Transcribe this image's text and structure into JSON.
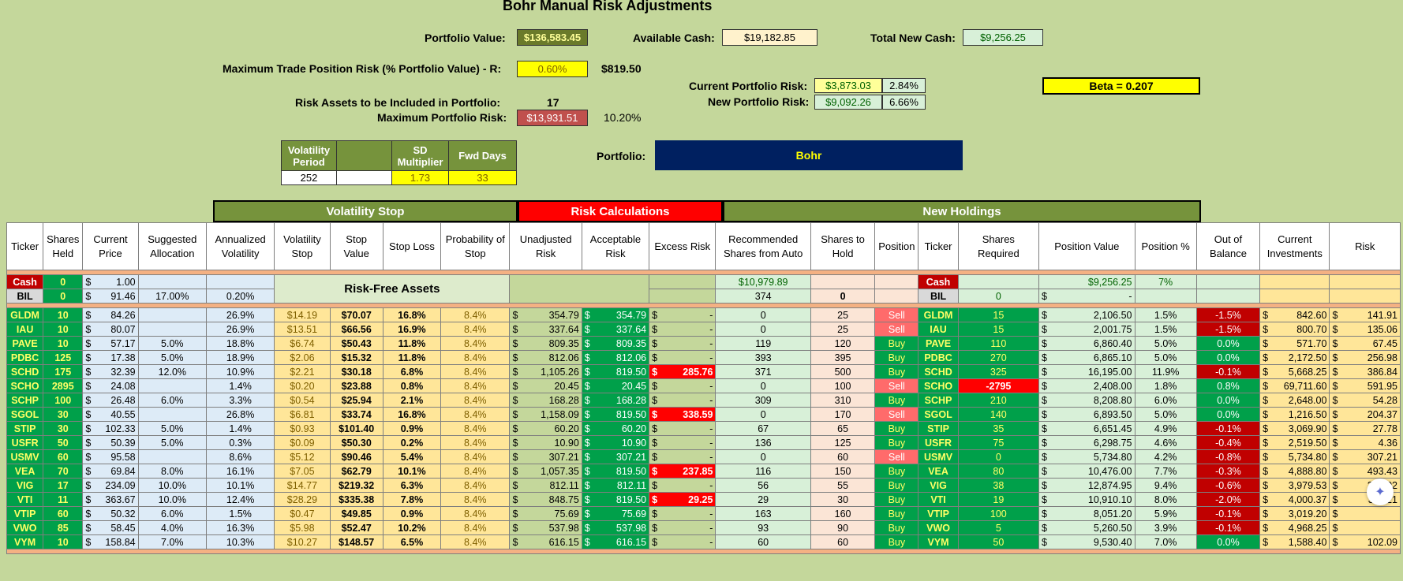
{
  "title": "Bohr Manual Risk Adjustments",
  "top": {
    "portfolio_value_label": "Portfolio Value:",
    "portfolio_value": "$136,583.45",
    "available_cash_label": "Available Cash:",
    "available_cash": "$19,182.85",
    "total_new_cash_label": "Total New Cash:",
    "total_new_cash": "$9,256.25",
    "max_trade_label": "Maximum Trade Position Risk (% Portfolio Value) - R:",
    "max_trade_pct": "0.60%",
    "max_trade_value": "$819.50",
    "current_risk_label": "Current Portfolio Risk:",
    "current_risk_value": "$3,873.03",
    "current_risk_pct": "2.84%",
    "new_risk_label": "New Portfolio Risk:",
    "new_risk_value": "$9,092.26",
    "new_risk_pct": "6.66%",
    "beta": "Beta = 0.207",
    "risk_assets_label": "Risk Assets to be Included in Portfolio:",
    "risk_assets_count": "17",
    "max_portfolio_risk_label": "Maximum Portfolio Risk:",
    "max_portfolio_risk_value": "$13,931.51",
    "max_portfolio_risk_pct": "10.20%",
    "portfolio_label": "Portfolio:",
    "portfolio_name": "Bohr"
  },
  "params": {
    "h1": "Volatility Period",
    "h2": "",
    "h3": "SD Multiplier",
    "h4": "Fwd Days",
    "v1": "252",
    "v2": "",
    "v3": "1.73",
    "v4": "33"
  },
  "groups": {
    "volatility_stop": "Volatility Stop",
    "risk_calculations": "Risk Calculations",
    "new_holdings": "New Holdings"
  },
  "headers": [
    "Ticker",
    "Shares Held",
    "Current Price",
    "Suggested Allocation",
    "Annualized Volatility",
    "Volatility Stop",
    "Stop Value",
    "Stop Loss",
    "Probability of Stop",
    "Unadjusted Risk",
    "Acceptable Risk",
    "Excess Risk",
    "Recommended Shares from Auto",
    "Shares to Hold",
    "Position",
    "Ticker",
    "Shares Required",
    "Position Value",
    "Position %",
    "Out of Balance",
    "Current Investments",
    "Risk"
  ],
  "cash_row": {
    "ticker": "Cash",
    "shares": "0",
    "price": "1.00",
    "rec": "$10,979.89",
    "ticker2": "Cash",
    "pos_value": "$9,256.25",
    "pos_pct": "7%"
  },
  "bil_row": {
    "ticker": "BIL",
    "shares": "0",
    "price": "91.46",
    "alloc": "17.00%",
    "vol": "0.20%",
    "label": "Risk-Free Assets",
    "rec": "374",
    "hold": "0",
    "ticker2": "BIL",
    "req": "0",
    "pos_value": "-"
  },
  "rows": [
    {
      "t": "GLDM",
      "s": "10",
      "p": "84.26",
      "a": "",
      "v": "26.9%",
      "vs": "$14.19",
      "sv": "$70.07",
      "sl": "16.8%",
      "pb": "8.4%",
      "ur": "354.79",
      "ar": "354.79",
      "ex": "-",
      "rec": "0",
      "hold": "25",
      "pos": "Sell",
      "req": "15",
      "pv": "2,106.50",
      "pp": "1.5%",
      "ob": "-1.5%",
      "ci": "842.60",
      "rk": "141.91"
    },
    {
      "t": "IAU",
      "s": "10",
      "p": "80.07",
      "a": "",
      "v": "26.9%",
      "vs": "$13.51",
      "sv": "$66.56",
      "sl": "16.9%",
      "pb": "8.4%",
      "ur": "337.64",
      "ar": "337.64",
      "ex": "-",
      "rec": "0",
      "hold": "25",
      "pos": "Sell",
      "req": "15",
      "pv": "2,001.75",
      "pp": "1.5%",
      "ob": "-1.5%",
      "ci": "800.70",
      "rk": "135.06"
    },
    {
      "t": "PAVE",
      "s": "10",
      "p": "57.17",
      "a": "5.0%",
      "v": "18.8%",
      "vs": "$6.74",
      "sv": "$50.43",
      "sl": "11.8%",
      "pb": "8.4%",
      "ur": "809.35",
      "ar": "809.35",
      "ex": "-",
      "rec": "119",
      "hold": "120",
      "pos": "Buy",
      "req": "110",
      "pv": "6,860.40",
      "pp": "5.0%",
      "ob": "0.0%",
      "ci": "571.70",
      "rk": "67.45"
    },
    {
      "t": "PDBC",
      "s": "125",
      "p": "17.38",
      "a": "5.0%",
      "v": "18.9%",
      "vs": "$2.06",
      "sv": "$15.32",
      "sl": "11.8%",
      "pb": "8.4%",
      "ur": "812.06",
      "ar": "812.06",
      "ex": "-",
      "rec": "393",
      "hold": "395",
      "pos": "Buy",
      "req": "270",
      "pv": "6,865.10",
      "pp": "5.0%",
      "ob": "0.0%",
      "ci": "2,172.50",
      "rk": "256.98"
    },
    {
      "t": "SCHD",
      "s": "175",
      "p": "32.39",
      "a": "12.0%",
      "v": "10.9%",
      "vs": "$2.21",
      "sv": "$30.18",
      "sl": "6.8%",
      "pb": "8.4%",
      "ur": "1,105.26",
      "ar": "819.50",
      "ex": "285.76",
      "rec": "371",
      "hold": "500",
      "pos": "Buy",
      "req": "325",
      "pv": "16,195.00",
      "pp": "11.9%",
      "ob": "-0.1%",
      "ci": "5,668.25",
      "rk": "386.84"
    },
    {
      "t": "SCHO",
      "s": "2895",
      "p": "24.08",
      "a": "",
      "v": "1.4%",
      "vs": "$0.20",
      "sv": "$23.88",
      "sl": "0.8%",
      "pb": "8.4%",
      "ur": "20.45",
      "ar": "20.45",
      "ex": "-",
      "rec": "0",
      "hold": "100",
      "pos": "Sell",
      "req": "-2795",
      "pv": "2,408.00",
      "pp": "1.8%",
      "ob": "0.8%",
      "ci": "69,711.60",
      "rk": "591.95"
    },
    {
      "t": "SCHP",
      "s": "100",
      "p": "26.48",
      "a": "6.0%",
      "v": "3.3%",
      "vs": "$0.54",
      "sv": "$25.94",
      "sl": "2.1%",
      "pb": "8.4%",
      "ur": "168.28",
      "ar": "168.28",
      "ex": "-",
      "rec": "309",
      "hold": "310",
      "pos": "Buy",
      "req": "210",
      "pv": "8,208.80",
      "pp": "6.0%",
      "ob": "0.0%",
      "ci": "2,648.00",
      "rk": "54.28"
    },
    {
      "t": "SGOL",
      "s": "30",
      "p": "40.55",
      "a": "",
      "v": "26.8%",
      "vs": "$6.81",
      "sv": "$33.74",
      "sl": "16.8%",
      "pb": "8.4%",
      "ur": "1,158.09",
      "ar": "819.50",
      "ex": "338.59",
      "rec": "0",
      "hold": "170",
      "pos": "Sell",
      "req": "140",
      "pv": "6,893.50",
      "pp": "5.0%",
      "ob": "0.0%",
      "ci": "1,216.50",
      "rk": "204.37"
    },
    {
      "t": "STIP",
      "s": "30",
      "p": "102.33",
      "a": "5.0%",
      "v": "1.4%",
      "vs": "$0.93",
      "sv": "$101.40",
      "sl": "0.9%",
      "pb": "8.4%",
      "ur": "60.20",
      "ar": "60.20",
      "ex": "-",
      "rec": "67",
      "hold": "65",
      "pos": "Buy",
      "req": "35",
      "pv": "6,651.45",
      "pp": "4.9%",
      "ob": "-0.1%",
      "ci": "3,069.90",
      "rk": "27.78"
    },
    {
      "t": "USFR",
      "s": "50",
      "p": "50.39",
      "a": "5.0%",
      "v": "0.3%",
      "vs": "$0.09",
      "sv": "$50.30",
      "sl": "0.2%",
      "pb": "8.4%",
      "ur": "10.90",
      "ar": "10.90",
      "ex": "-",
      "rec": "136",
      "hold": "125",
      "pos": "Buy",
      "req": "75",
      "pv": "6,298.75",
      "pp": "4.6%",
      "ob": "-0.4%",
      "ci": "2,519.50",
      "rk": "4.36"
    },
    {
      "t": "USMV",
      "s": "60",
      "p": "95.58",
      "a": "",
      "v": "8.6%",
      "vs": "$5.12",
      "sv": "$90.46",
      "sl": "5.4%",
      "pb": "8.4%",
      "ur": "307.21",
      "ar": "307.21",
      "ex": "-",
      "rec": "0",
      "hold": "60",
      "pos": "Sell",
      "req": "0",
      "pv": "5,734.80",
      "pp": "4.2%",
      "ob": "-0.8%",
      "ci": "5,734.80",
      "rk": "307.21"
    },
    {
      "t": "VEA",
      "s": "70",
      "p": "69.84",
      "a": "8.0%",
      "v": "16.1%",
      "vs": "$7.05",
      "sv": "$62.79",
      "sl": "10.1%",
      "pb": "8.4%",
      "ur": "1,057.35",
      "ar": "819.50",
      "ex": "237.85",
      "rec": "116",
      "hold": "150",
      "pos": "Buy",
      "req": "80",
      "pv": "10,476.00",
      "pp": "7.7%",
      "ob": "-0.3%",
      "ci": "4,888.80",
      "rk": "493.43"
    },
    {
      "t": "VIG",
      "s": "17",
      "p": "234.09",
      "a": "10.0%",
      "v": "10.1%",
      "vs": "$14.77",
      "sv": "$219.32",
      "sl": "6.3%",
      "pb": "8.4%",
      "ur": "812.11",
      "ar": "812.11",
      "ex": "-",
      "rec": "56",
      "hold": "55",
      "pos": "Buy",
      "req": "38",
      "pv": "12,874.95",
      "pp": "9.4%",
      "ob": "-0.6%",
      "ci": "3,979.53",
      "rk": "251.02"
    },
    {
      "t": "VTI",
      "s": "11",
      "p": "363.67",
      "a": "10.0%",
      "v": "12.4%",
      "vs": "$28.29",
      "sv": "$335.38",
      "sl": "7.8%",
      "pb": "8.4%",
      "ur": "848.75",
      "ar": "819.50",
      "ex": "29.25",
      "rec": "29",
      "hold": "30",
      "pos": "Buy",
      "req": "19",
      "pv": "10,910.10",
      "pp": "8.0%",
      "ob": "-2.0%",
      "ci": "4,000.37",
      "rk": "311.21"
    },
    {
      "t": "VTIP",
      "s": "60",
      "p": "50.32",
      "a": "6.0%",
      "v": "1.5%",
      "vs": "$0.47",
      "sv": "$49.85",
      "sl": "0.9%",
      "pb": "8.4%",
      "ur": "75.69",
      "ar": "75.69",
      "ex": "-",
      "rec": "163",
      "hold": "160",
      "pos": "Buy",
      "req": "100",
      "pv": "8,051.20",
      "pp": "5.9%",
      "ob": "-0.1%",
      "ci": "3,019.20",
      "rk": ""
    },
    {
      "t": "VWO",
      "s": "85",
      "p": "58.45",
      "a": "4.0%",
      "v": "16.3%",
      "vs": "$5.98",
      "sv": "$52.47",
      "sl": "10.2%",
      "pb": "8.4%",
      "ur": "537.98",
      "ar": "537.98",
      "ex": "-",
      "rec": "93",
      "hold": "90",
      "pos": "Buy",
      "req": "5",
      "pv": "5,260.50",
      "pp": "3.9%",
      "ob": "-0.1%",
      "ci": "4,968.25",
      "rk": ""
    },
    {
      "t": "VYM",
      "s": "10",
      "p": "158.84",
      "a": "7.0%",
      "v": "10.3%",
      "vs": "$10.27",
      "sv": "$148.57",
      "sl": "6.5%",
      "pb": "8.4%",
      "ur": "616.15",
      "ar": "616.15",
      "ex": "-",
      "rec": "60",
      "hold": "60",
      "pos": "Buy",
      "req": "50",
      "pv": "9,530.40",
      "pp": "7.0%",
      "ob": "0.0%",
      "ci": "1,588.40",
      "rk": "102.09"
    }
  ],
  "colors": {
    "bg": "#c4d79b",
    "green": "#00a04a",
    "navy": "#002060",
    "red": "#c0504d"
  }
}
